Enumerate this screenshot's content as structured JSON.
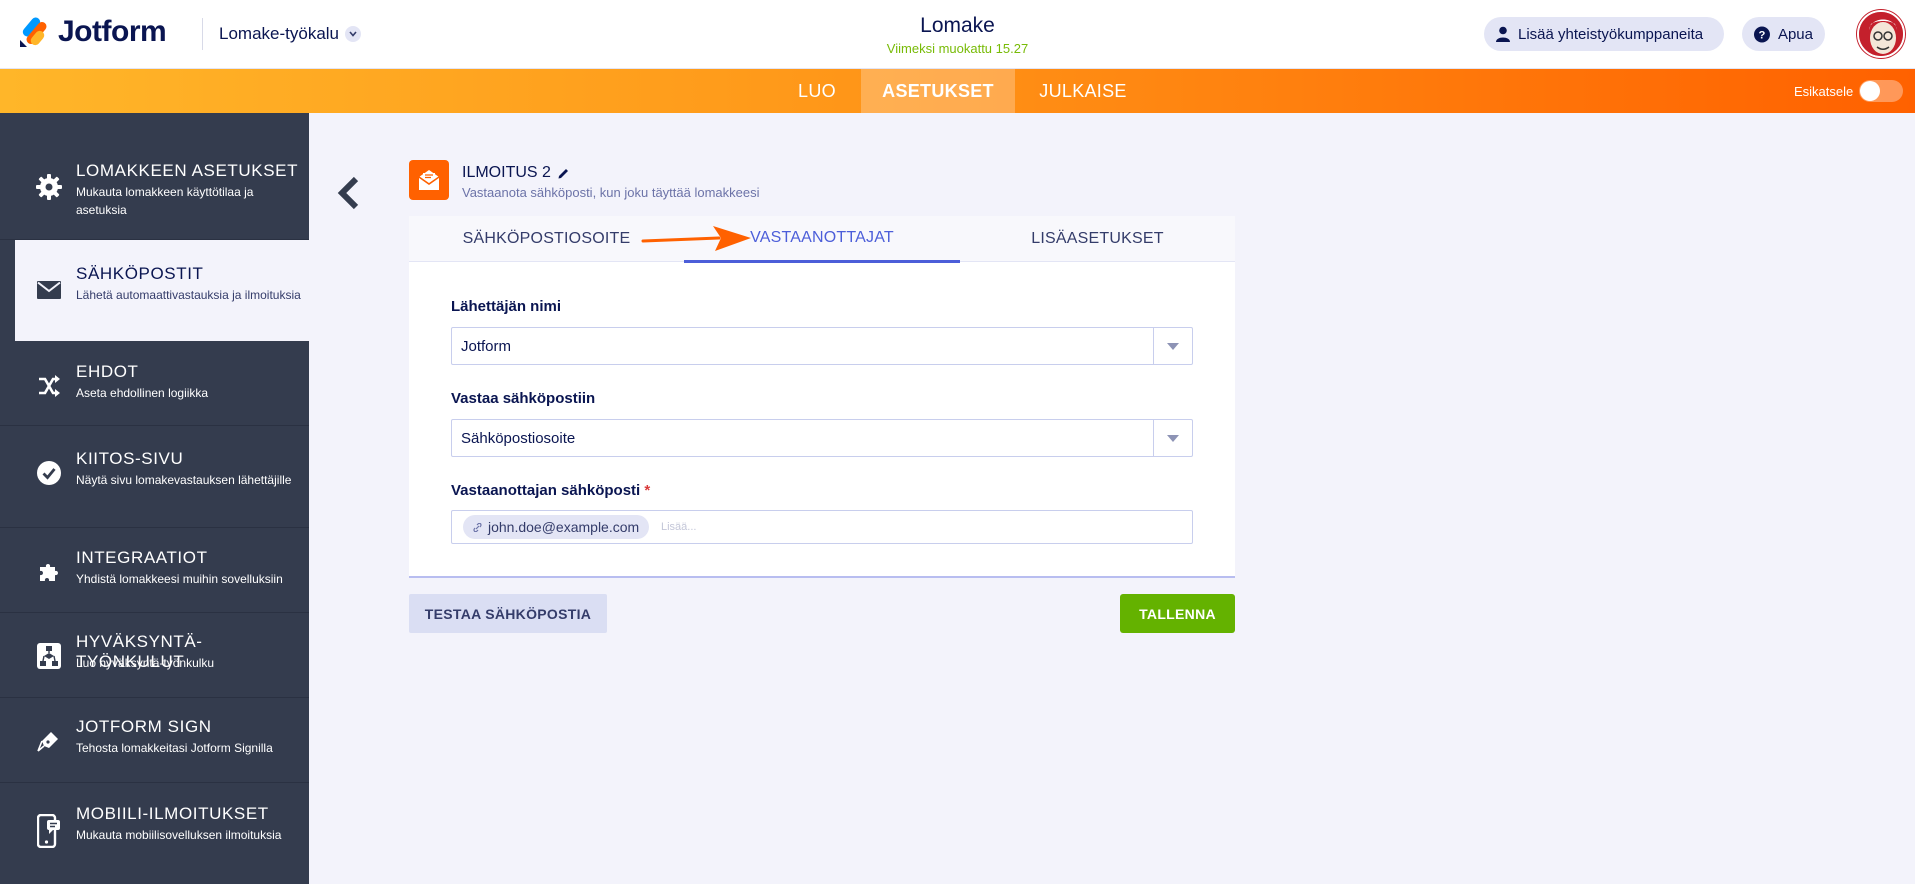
{
  "header": {
    "brand": "Jotform",
    "tool_name": "Lomake-työkalu",
    "doc_title": "Lomake",
    "last_edited": "Viimeksi muokattu 15.27",
    "collab_label": "Lisää yhteistyökumppaneita",
    "help_label": "Apua"
  },
  "nav": {
    "tabs": [
      {
        "label": "LUO"
      },
      {
        "label": "ASETUKSET",
        "active": true
      },
      {
        "label": "JULKAISE"
      }
    ],
    "preview_label": "Esikatsele"
  },
  "sidebar": {
    "items": [
      {
        "title": "LOMAKKEEN ASETUKSET",
        "desc": "Mukauta lomakkeen käyttötilaa ja asetuksia",
        "icon": "gear-icon"
      },
      {
        "title": "SÄHKÖPOSTIT",
        "desc": "Lähetä automaattivastauksia ja ilmoituksia",
        "icon": "envelope-icon",
        "active": true
      },
      {
        "title": "EHDOT",
        "desc": "Aseta ehdollinen logiikka",
        "icon": "conditions-icon"
      },
      {
        "title": "KIITOS-SIVU",
        "desc": "Näytä sivu lomakevastauksen lähettäjille",
        "icon": "check-circle-icon"
      },
      {
        "title": "INTEGRAATIOT",
        "desc": "Yhdistä lomakkeesi muihin sovelluksiin",
        "icon": "puzzle-icon"
      },
      {
        "title": "HYVÄKSYNTÄ-TYÖNKULUT",
        "desc": "Luo hyväksyntä-työnkulku",
        "icon": "workflow-icon"
      },
      {
        "title": "JOTFORM SIGN",
        "desc": "Tehosta lomakkeitasi Jotform Signilla",
        "icon": "pen-icon"
      },
      {
        "title": "MOBIILI-ILMOITUKSET",
        "desc": "Mukauta mobiilisovelluksen ilmoituksia",
        "icon": "mobile-icon"
      }
    ]
  },
  "notification": {
    "title": "ILMOITUS 2",
    "subtitle": "Vastaanota sähköposti, kun joku täyttää lomakkeesi"
  },
  "tabs": [
    {
      "label": "SÄHKÖPOSTIOSOITE"
    },
    {
      "label": "VASTAANOTTAJAT",
      "active": true
    },
    {
      "label": "LISÄASETUKSET"
    }
  ],
  "form": {
    "sender_name_label": "Lähettäjän nimi",
    "sender_name_value": "Jotform",
    "reply_to_label": "Vastaa sähköpostiin",
    "reply_to_value": "Sähköpostiosoite",
    "recipient_label": "Vastaanottajan sähköposti",
    "required_mark": "*",
    "recipient_tag": "john.doe@example.com",
    "recipient_placeholder": "Lisää..."
  },
  "buttons": {
    "test_label": "TESTAA SÄHKÖPOSTIA",
    "save_label": "TALLENNA"
  },
  "colors": {
    "brand_orange": "#ff6100",
    "save_green": "#64b200",
    "active_tab": "#4c5ed9",
    "sidebar_bg": "#343c4e"
  }
}
